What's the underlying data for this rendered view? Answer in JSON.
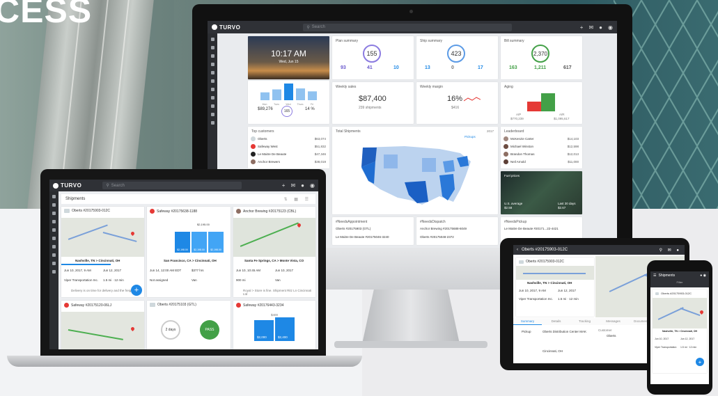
{
  "headline": "CESS",
  "brand": {
    "name": "TURVO",
    "accent": "#1e88e5",
    "purple": "#8b7be0"
  },
  "desktop": {
    "search_placeholder": "Search",
    "hero": {
      "time": "10:17 AM",
      "date": "Wed, Jun 15"
    },
    "weekly_bars": {
      "days": [
        "Mon",
        "Tues",
        "Wed",
        "Thurs",
        "Fri"
      ],
      "values": [
        40,
        55,
        85,
        60,
        45
      ]
    },
    "mini_stats": {
      "amount": "$89,276",
      "ring": "165",
      "pct": "14 %"
    },
    "plan_summary": {
      "title": "Plan summary",
      "total": "155",
      "stats": [
        "93",
        "41",
        "10"
      ]
    },
    "ship_summary": {
      "title": "Ship summary",
      "total": "423",
      "stats": [
        "13",
        "0",
        "17"
      ]
    },
    "bill_summary": {
      "title": "Bill summary",
      "total": "2,370",
      "stats": [
        "163",
        "1,211",
        "617"
      ]
    },
    "weekly_sales": {
      "title": "Weekly sales",
      "value": "$87,400",
      "sub": "239 shipments"
    },
    "weekly_margin": {
      "title": "Weekly margin",
      "value": "16%",
      "sub": "$416"
    },
    "aging": {
      "title": "Aging",
      "ap": "A/P",
      "ar": "A/R",
      "ap_val": "$770,239",
      "ar_val": "$1,095,617"
    },
    "top_customers": {
      "title": "Top customers",
      "rows": [
        {
          "name": "Oberts",
          "amt": "$63,074"
        },
        {
          "name": "Safeway West",
          "amt": "$51,832"
        },
        {
          "name": "Le Maitre De Beaute",
          "amt": "$47,346"
        },
        {
          "name": "Anchor Brewers",
          "amt": "$38,019"
        }
      ]
    },
    "total_shipments": {
      "title": "Total Shipments",
      "year": "2017",
      "tab": "Pickups"
    },
    "leaderboard": {
      "title": "Leaderboard",
      "rows": [
        {
          "name": "McKenzie Carter",
          "amt": "$14,103"
        },
        {
          "name": "Michael Winston",
          "amt": "$12,598"
        },
        {
          "name": "Brandon Thomas",
          "amt": "$12,013"
        },
        {
          "name": "Neil Arnold",
          "amt": "$11,000"
        }
      ]
    },
    "fuel": {
      "title": "Fuel prices",
      "us_label": "U.S. average",
      "us_val": "$2.58",
      "last_label": "Last 30 days",
      "last_val": "$2.67"
    },
    "bottom_cards": [
      "#NeedsAppointment",
      "#NeedsDispatch",
      "#NeedsPickup"
    ],
    "bottom_rows": [
      "Oberts #20175903 (GTL)",
      "Anchor Brewing #20175688-6049",
      "Le Maitre De Beaute #20171...22-4421",
      "Le Maitre De Beaute #20175046-3240",
      "Oberts #20175048-2372"
    ]
  },
  "laptop": {
    "search_placeholder": "Search",
    "page_title": "Shipments",
    "cards": [
      {
        "title": "Oberts #20175903-012C",
        "route": "Nashville, TN > Cincinnati, OH",
        "pickup": "Jun 10, 2017, 9 AM",
        "delivery": "Jun 12, 2017",
        "carrier": "Viper Transportation Inc.",
        "distance": "1.5 mi · 12 min"
      },
      {
        "title": "Safeway #20175638-1188",
        "route": "San Francisco, CA > Cincinnati, OH",
        "pickup": "Jun 14, 12:00 AM EDT",
        "delivery": "$377 hrs",
        "carrier": "Not assigned",
        "distance": "Van"
      },
      {
        "title": "Anchor Brewing #20175123 (CBL)",
        "route": "Santa Fe Springs, CA > Monte Vista, CO",
        "pickup": "Jun 10, 10:45 AM",
        "delivery": "Jun 10, 2017",
        "carrier": "900 mi",
        "distance": "Van"
      },
      {
        "title": "Safeway #20175120-06LJ",
        "route": "",
        "pickup": "",
        "delivery": "",
        "carrier": "",
        "distance": ""
      },
      {
        "title": "Oberts #20175103 (GTL)",
        "route": "",
        "pickup": "",
        "delivery": "",
        "carrier": "",
        "distance": ""
      },
      {
        "title": "Safeway #20176443-3234",
        "route": "",
        "pickup": "",
        "delivery": "",
        "carrier": "",
        "distance": ""
      }
    ],
    "bar_values": {
      "a": "$2,195.00",
      "b": "$2,198.00",
      "c": "$2,198.00",
      "d": "$2,198.00"
    },
    "days_label": "2 days",
    "pass_label": "PASS",
    "bar2": {
      "top": "$400",
      "a": "$2,000",
      "b": "$2,400"
    },
    "note": "Delivery is on time for delivery and the freight...",
    "note2": "Royal > Store is fine. Shipment Ritz Ln Cincinnati Ltd"
  },
  "tablet": {
    "title": "Oberts #20175903-012C",
    "card_title": "Oberts #20175903-012C",
    "route": "Nashville, TN > Cincinnati, OH",
    "pickup": "Jun 10, 2017, 9 AM",
    "delivery": "Jun 12, 2017",
    "carrier": "Viper Transportation Inc.",
    "distance": "1.5 mi · 12 min",
    "tabs": [
      "Summary",
      "Details",
      "Tracking",
      "Messages",
      "Documents",
      "Transactions"
    ],
    "pickup_label": "Pickup",
    "pickup_place": "Oberts Distribution Center MAK",
    "customer_label": "Customer",
    "customer": "Oberts",
    "amount": "$837.00",
    "stop": "Cincinnati, OH"
  },
  "phone": {
    "title": "Shipments",
    "filter": "Filter",
    "card_title": "Oberts #20175903-012C",
    "route": "Nashville, TN > Cincinnati, OH",
    "pickup": "Jun 10, 2017",
    "delivery": "Jun 12, 2017",
    "carrier": "Viper Transportation",
    "distance": "1.5 mi · 12 min"
  }
}
